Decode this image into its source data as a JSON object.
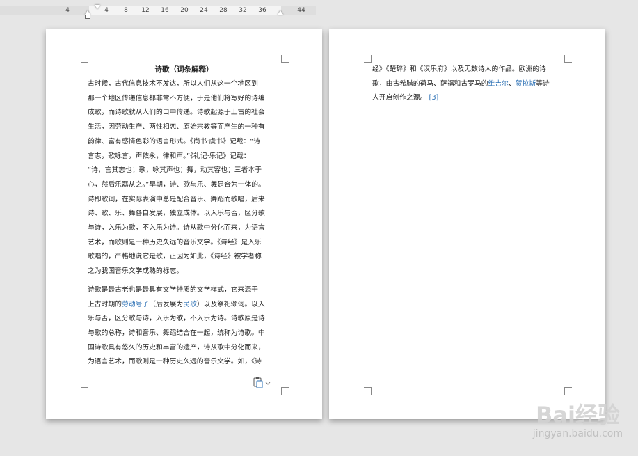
{
  "ruler": {
    "ticks": [
      "4",
      "4",
      "8",
      "12",
      "16",
      "20",
      "24",
      "28",
      "32",
      "36",
      "44"
    ]
  },
  "page1": {
    "title": "诗歌（词条解释）",
    "lines": [
      [
        {
          "t": "    古时候，古代信息技术不发达，所以人们从这一个地区到"
        }
      ],
      [
        {
          "t": "那一个地区传递信息都非常不方便，于是他们将写好的诗编"
        }
      ],
      [
        {
          "t": "成歌，而诗歌就从人们的口中传递。诗歌起源于上古的社会"
        }
      ],
      [
        {
          "t": "生活，因劳动生产、两性相恋、原始宗教等而产生的一种有"
        }
      ],
      [
        {
          "t": "韵律、富有感情色彩的语言形式。《尚书·虞书》记载：“诗"
        }
      ],
      [
        {
          "t": "言志，歌咏言，声依永，律和声。”《礼记·乐记》记载："
        }
      ],
      [
        {
          "t": "“诗，言其志也；歌，咏其声也；舞，动其容也；三者本于"
        }
      ],
      [
        {
          "t": "心，然后乐器从之。”早期，诗、歌与乐、舞是合为一体的。"
        }
      ],
      [
        {
          "t": "诗即歌词，在实际表演中总是配合音乐、舞蹈而歌唱，后来"
        }
      ],
      [
        {
          "t": "诗、歌、乐、舞各自发展，独立成体。以入乐与否，区分歌"
        }
      ],
      [
        {
          "t": "与诗，入乐为歌，不入乐为诗。诗从歌中分化而来，为语言"
        }
      ],
      [
        {
          "t": "艺术，而歌则是一种历史久远的音乐文学。《诗经》是入乐"
        }
      ],
      [
        {
          "t": "歌唱的，严格地说它是歌，正因为如此，《诗经》被学者称"
        }
      ],
      [
        {
          "t": "之为我国音乐文学成熟的标志。"
        }
      ],
      [
        {
          "t": "    诗歌是最古老也是最具有文学特质的文学样式，它来源于"
        }
      ],
      [
        {
          "t": "上古时期的"
        },
        {
          "t": "劳动号子",
          "link": true
        },
        {
          "t": "（后发展为"
        },
        {
          "t": "民歌",
          "link": true
        },
        {
          "t": "）以及祭祀颂词。以入"
        }
      ],
      [
        {
          "t": "乐与否，区分歌与诗，入乐为歌，不入乐为诗。诗歌原是诗"
        }
      ],
      [
        {
          "t": "与歌的总称，诗和音乐、舞蹈结合在一起，统称为诗歌。中"
        }
      ],
      [
        {
          "t": "国诗歌具有悠久的历史和丰富的遗产，诗从歌中分化而来，"
        }
      ],
      [
        {
          "t": "为语言艺术，而歌则是一种历史久远的音乐文学。如，《诗"
        }
      ]
    ]
  },
  "page2": {
    "lines": [
      [
        {
          "t": "经》《楚辞》和《汉乐府》以及无数诗人的作品。欧洲的诗"
        }
      ],
      [
        {
          "t": "歌，由古希腊的荷马、萨福和古罗马的"
        },
        {
          "t": "维吉尔",
          "link": true
        },
        {
          "t": "、"
        },
        {
          "t": "贺拉斯",
          "link": true
        },
        {
          "t": "等诗"
        }
      ],
      [
        {
          "t": "人开启创作之源。  "
        },
        {
          "t": "[3]",
          "link": true
        }
      ]
    ]
  },
  "watermark": {
    "main": "Bai经验",
    "sub": "jingyan.baidu.com"
  }
}
